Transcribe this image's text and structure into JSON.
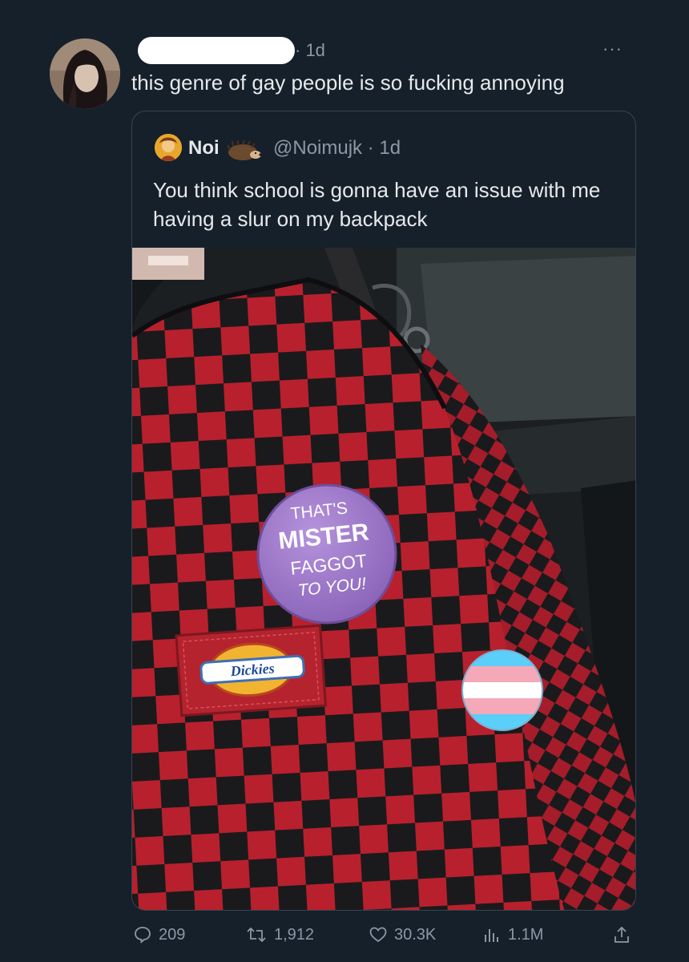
{
  "tweet": {
    "timestamp": "· 1d",
    "more_label": "···",
    "text": "this genre of gay people is so fucking annoying"
  },
  "quoted_tweet": {
    "display_name": "Noi",
    "handle": "@Noimujk · 1d",
    "text": "You think school is gonna have an issue with me having a slur on my backpack",
    "photo": {
      "button_lines": [
        "THAT'S",
        "MISTER",
        "FAGGOT",
        "TO YOU!"
      ],
      "label_text": "Dickies",
      "colors": {
        "red_check": "#b8202e",
        "black_check": "#1a1a1c",
        "button_purple": "#a07ac9",
        "trans_blue": "#5bcefa",
        "trans_pink": "#f5a9b8"
      }
    }
  },
  "actions": {
    "replies": "209",
    "retweets": "1,912",
    "likes": "30.3K",
    "views": "1.1M",
    "icons": [
      "reply-icon",
      "retweet-icon",
      "like-icon",
      "views-icon",
      "share-icon"
    ]
  },
  "colors": {
    "background": "#15202b",
    "text_primary": "#e7e9ea",
    "text_secondary": "#8b98a5",
    "border": "#38444d"
  }
}
